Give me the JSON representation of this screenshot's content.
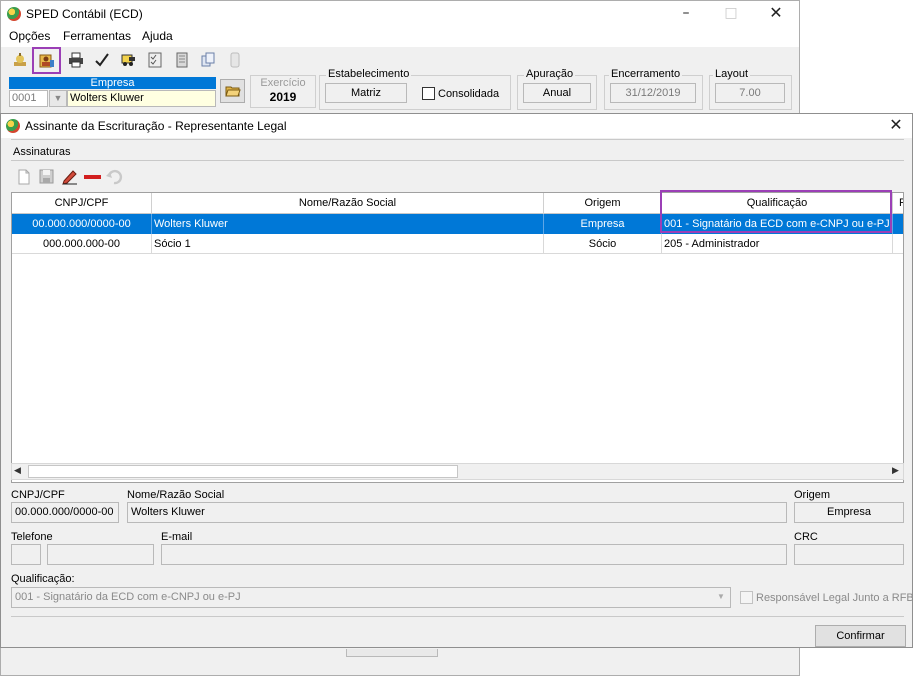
{
  "main_window": {
    "title": "SPED Contábil (ECD)",
    "menu": [
      "Opções",
      "Ferramentas",
      "Ajuda"
    ],
    "empresa": {
      "header": "Empresa",
      "code": "0001",
      "name": "Wolters Kluwer"
    },
    "exercicio": {
      "label": "Exercício",
      "value": "2019"
    },
    "estabelecimento": {
      "label": "Estabelecimento",
      "value": "Matriz",
      "consolidada_label": "Consolidada"
    },
    "apuracao": {
      "label": "Apuração",
      "value": "Anual"
    },
    "encerramento": {
      "label": "Encerramento",
      "value": "31/12/2019"
    },
    "layout": {
      "label": "Layout",
      "value": "7.00"
    },
    "toolbar_icons": [
      "lamp-icon",
      "signature-user-icon",
      "print-icon",
      "check-icon",
      "car-icon",
      "checklist-icon",
      "book-icon",
      "copy-icon",
      "mobile-icon"
    ]
  },
  "dialog": {
    "title": "Assinante da Escrituração - Representante Legal",
    "section": "Assinaturas",
    "grid": {
      "columns": [
        "CNPJ/CPF",
        "Nome/Razão Social",
        "Origem",
        "Qualificação",
        "R"
      ],
      "rows": [
        {
          "cnpj": "00.000.000/0000-00",
          "nome": "Wolters Kluwer",
          "origem": "Empresa",
          "qualificacao": "001 - Signatário da ECD com e-CNPJ ou e-PJ",
          "selected": true
        },
        {
          "cnpj": "000.000.000-00",
          "nome": "Sócio 1",
          "origem": "Sócio",
          "qualificacao": "205 - Administrador",
          "selected": false
        }
      ]
    },
    "form": {
      "cnpj_label": "CNPJ/CPF",
      "cnpj_value": "00.000.000/0000-00",
      "nome_label": "Nome/Razão Social",
      "nome_value": "Wolters Kluwer",
      "origem_label": "Origem",
      "origem_value": "Empresa",
      "telefone_label": "Telefone",
      "email_label": "E-mail",
      "crc_label": "CRC",
      "qualificacao_label": "Qualificação:",
      "qualificacao_value": "001 - Signatário da ECD com e-CNPJ ou e-PJ",
      "responsavel_label": "Responsável Legal Junto a RFB"
    },
    "confirm_button": "Confirmar"
  },
  "colors": {
    "selection": "#0078d7",
    "highlight": "#9b3fb6",
    "empresa_header": "#0078d7"
  }
}
